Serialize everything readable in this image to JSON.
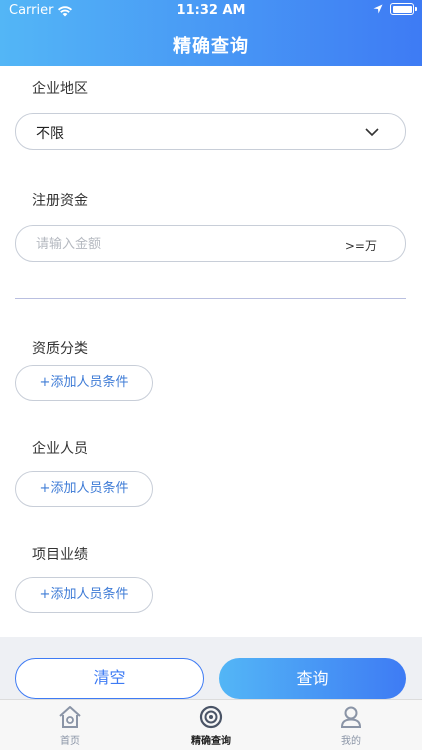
{
  "status_bar": {
    "carrier": "Carrier",
    "time": "11:32 AM"
  },
  "nav": {
    "title": "精确查询"
  },
  "form": {
    "region": {
      "label": "企业地区",
      "value": "不限"
    },
    "capital": {
      "label": "注册资金",
      "placeholder": "请输入金额",
      "unit": ">=万"
    },
    "sections": [
      {
        "label": "资质分类",
        "button": "+添加人员条件"
      },
      {
        "label": "企业人员",
        "button": "+添加人员条件"
      },
      {
        "label": "项目业绩",
        "button": "+添加人员条件"
      }
    ]
  },
  "actions": {
    "clear": "清空",
    "query": "查询"
  },
  "tabs": [
    {
      "label": "首页",
      "icon": "home-icon"
    },
    {
      "label": "精确查询",
      "icon": "search-target-icon",
      "active": true
    },
    {
      "label": "我的",
      "icon": "person-icon"
    }
  ],
  "colors": {
    "accent": "#3e7bf4",
    "gradient_start": "#53b6f6",
    "link": "#3e7bd6"
  }
}
